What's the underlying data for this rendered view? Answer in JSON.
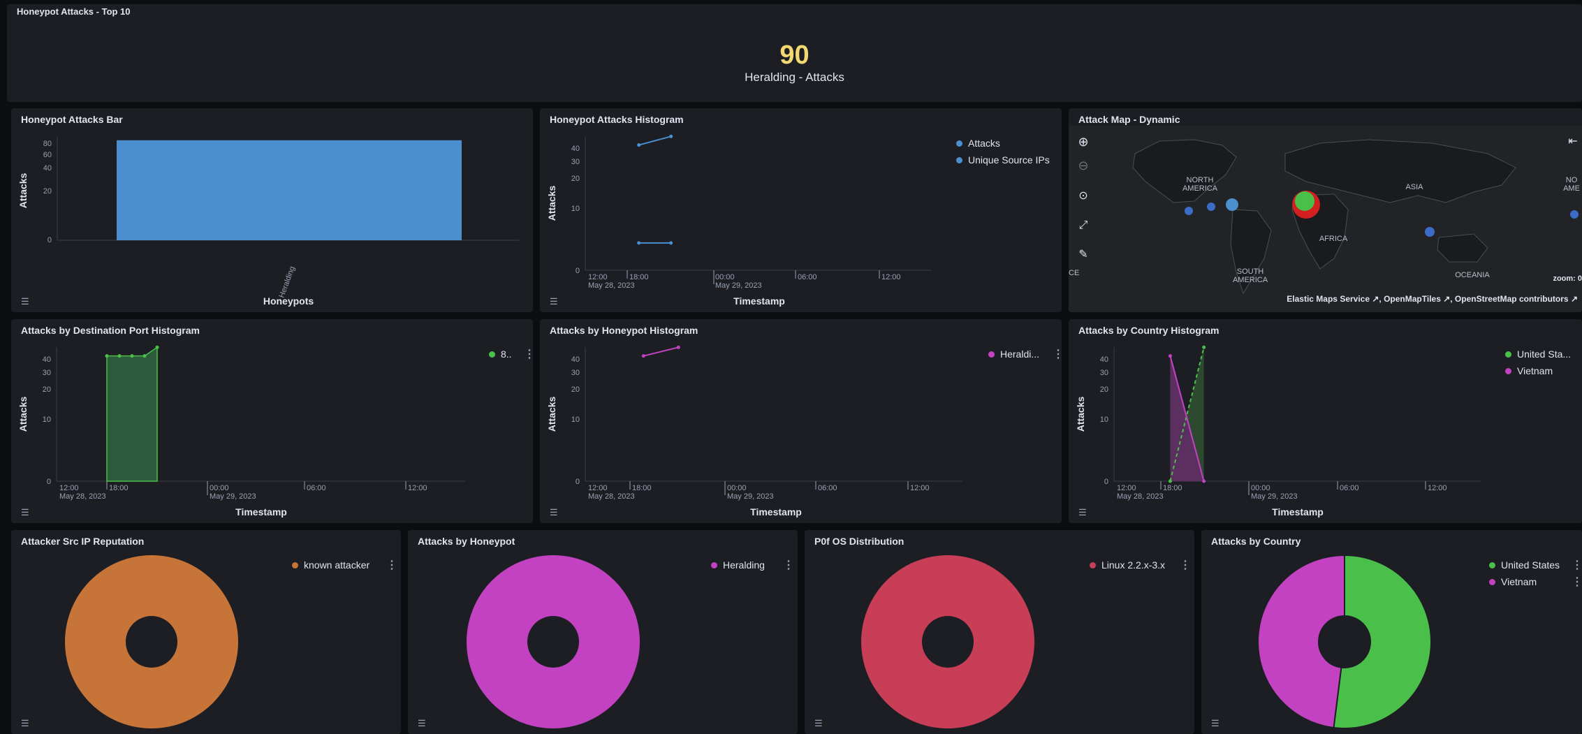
{
  "metric_panel": {
    "title": "Honeypot Attacks - Top 10",
    "value": "90",
    "label": "Heralding - Attacks",
    "value_color": "#f1d86f"
  },
  "bar_panel": {
    "title": "Honeypot Attacks Bar",
    "xlabel": "Honeypots",
    "ylabel": "Attacks",
    "category": "Heralding",
    "y_ticks": [
      "80",
      "60",
      "40",
      "20",
      "0"
    ]
  },
  "histogram_panel": {
    "title": "Honeypot Attacks Histogram",
    "xlabel": "Timestamp",
    "ylabel": "Attacks",
    "legend": [
      "Attacks",
      "Unique Source IPs"
    ],
    "y_ticks": [
      "40",
      "30",
      "20",
      "10",
      "0"
    ],
    "x_ticks": [
      "12:00",
      "18:00",
      "00:00",
      "06:00",
      "12:00"
    ],
    "x_dates": [
      "May 28, 2023",
      "May 29, 2023"
    ]
  },
  "map_panel": {
    "title": "Attack Map - Dynamic",
    "continents": [
      "NORTH AMERICA",
      "SOUTH AMERICA",
      "ASIA",
      "AFRICA",
      "OCEANIA",
      "NO AME",
      "CE"
    ],
    "zoom_label": "zoom: 0",
    "attribution": "Elastic Maps Service ↗, OpenMapTiles ↗, OpenStreetMap contributors ↗"
  },
  "port_panel": {
    "title": "Attacks by Destination Port Histogram",
    "xlabel": "Timestamp",
    "ylabel": "Attacks",
    "legend": [
      "8.."
    ],
    "y_ticks": [
      "40",
      "30",
      "20",
      "10",
      "0"
    ],
    "x_ticks": [
      "12:00",
      "18:00",
      "00:00",
      "06:00",
      "12:00"
    ],
    "x_dates": [
      "May 28, 2023",
      "May 29, 2023"
    ]
  },
  "honeypot_hist_panel": {
    "title": "Attacks by Honeypot Histogram",
    "xlabel": "Timestamp",
    "ylabel": "Attacks",
    "legend": [
      "Heraldi..."
    ],
    "y_ticks": [
      "40",
      "30",
      "20",
      "10",
      "0"
    ],
    "x_ticks": [
      "12:00",
      "18:00",
      "00:00",
      "06:00",
      "12:00"
    ],
    "x_dates": [
      "May 28, 2023",
      "May 29, 2023"
    ]
  },
  "country_hist_panel": {
    "title": "Attacks by Country Histogram",
    "xlabel": "Timestamp",
    "ylabel": "Attacks",
    "legend": [
      "United Sta...",
      "Vietnam"
    ],
    "y_ticks": [
      "40",
      "30",
      "20",
      "10",
      "0"
    ],
    "x_ticks": [
      "12:00",
      "18:00",
      "00:00",
      "06:00",
      "12:00"
    ],
    "x_dates": [
      "May 28, 2023",
      "May 29, 2023"
    ]
  },
  "reputation_panel": {
    "title": "Attacker Src IP Reputation",
    "legend": [
      "known attacker"
    ]
  },
  "by_honeypot_panel": {
    "title": "Attacks by Honeypot",
    "legend": [
      "Heralding"
    ]
  },
  "os_panel": {
    "title": "P0f OS Distribution",
    "legend": [
      "Linux 2.2.x-3.x"
    ]
  },
  "country_panel": {
    "title": "Attacks by Country",
    "legend": [
      "United States",
      "Vietnam"
    ]
  },
  "colors": {
    "blue": "#4b8fcf",
    "green": "#4ac04a",
    "magenta": "#c242c2",
    "orange": "#c67438",
    "crimson": "#c83e57",
    "yellow": "#f1d86f"
  },
  "chart_data": [
    {
      "type": "bar",
      "title": "Honeypot Attacks Bar",
      "xlabel": "Honeypots",
      "ylabel": "Attacks",
      "categories": [
        "Heralding"
      ],
      "values": [
        90
      ],
      "ylim": [
        0,
        90
      ],
      "scale": "sqrt"
    },
    {
      "type": "line",
      "title": "Honeypot Attacks Histogram",
      "xlabel": "Timestamp",
      "ylabel": "Attacks",
      "x": [
        "2023-05-28 17:00",
        "2023-05-28 20:00"
      ],
      "series": [
        {
          "name": "Attacks",
          "values": [
            42,
            48
          ]
        },
        {
          "name": "Unique Source IPs",
          "values": [
            2,
            2
          ]
        }
      ],
      "ylim": [
        0,
        50
      ],
      "scale": "sqrt"
    },
    {
      "type": "area",
      "title": "Attacks by Destination Port Histogram",
      "xlabel": "Timestamp",
      "ylabel": "Attacks",
      "x": [
        "2023-05-28 16:00",
        "2023-05-28 17:00",
        "2023-05-28 18:00",
        "2023-05-28 19:00",
        "2023-05-28 20:00"
      ],
      "series": [
        {
          "name": "8..",
          "values": [
            42,
            42,
            42,
            42,
            48
          ]
        }
      ],
      "ylim": [
        0,
        50
      ],
      "scale": "sqrt"
    },
    {
      "type": "line",
      "title": "Attacks by Honeypot Histogram",
      "xlabel": "Timestamp",
      "ylabel": "Attacks",
      "x": [
        "2023-05-28 17:00",
        "2023-05-28 20:00"
      ],
      "series": [
        {
          "name": "Heraldi...",
          "values": [
            42,
            48
          ]
        }
      ],
      "ylim": [
        0,
        50
      ],
      "scale": "sqrt"
    },
    {
      "type": "area",
      "title": "Attacks by Country Histogram",
      "xlabel": "Timestamp",
      "ylabel": "Attacks",
      "x": [
        "2023-05-28 17:00",
        "2023-05-28 20:00"
      ],
      "series": [
        {
          "name": "United Sta...",
          "values": [
            0,
            48
          ]
        },
        {
          "name": "Vietnam",
          "values": [
            42,
            0
          ]
        }
      ],
      "ylim": [
        0,
        50
      ],
      "scale": "sqrt"
    },
    {
      "type": "pie",
      "title": "Attacker Src IP Reputation",
      "categories": [
        "known attacker"
      ],
      "values": [
        100
      ]
    },
    {
      "type": "pie",
      "title": "Attacks by Honeypot",
      "categories": [
        "Heralding"
      ],
      "values": [
        100
      ]
    },
    {
      "type": "pie",
      "title": "P0f OS Distribution",
      "categories": [
        "Linux 2.2.x-3.x"
      ],
      "values": [
        100
      ]
    },
    {
      "type": "pie",
      "title": "Attacks by Country",
      "categories": [
        "United States",
        "Vietnam"
      ],
      "values": [
        52,
        48
      ]
    }
  ]
}
